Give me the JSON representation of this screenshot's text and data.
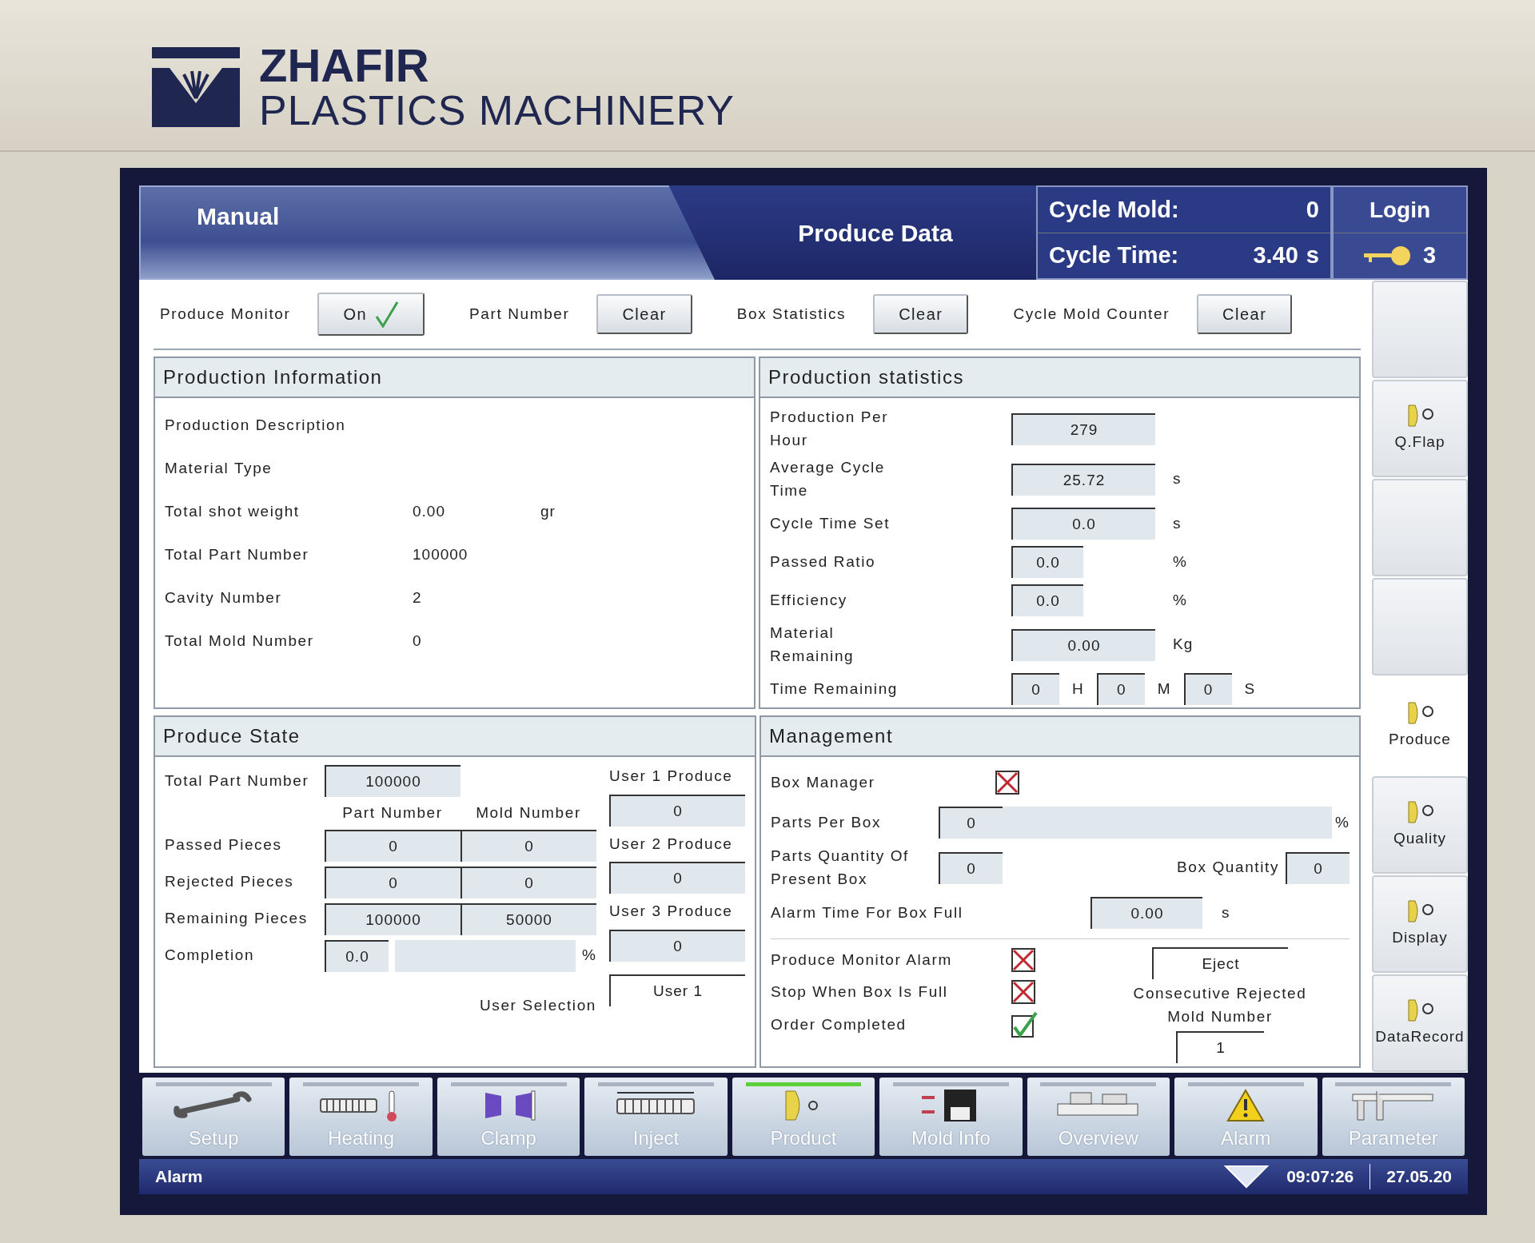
{
  "bezel": {
    "brand": "ZHAFIR",
    "subtitle": "PLASTICS MACHINERY"
  },
  "header": {
    "mode": "Manual",
    "title": "Produce Data",
    "cycle_mold_label": "Cycle Mold:",
    "cycle_mold": "0",
    "cycle_time_label": "Cycle Time:",
    "cycle_time": "3.40",
    "cycle_time_unit": "s",
    "login": "Login",
    "user_level": "3"
  },
  "toolbar": [
    {
      "kind": "toggle",
      "label": "Produce Monitor",
      "button": "On",
      "checked": true
    },
    {
      "kind": "clear",
      "label": "Part Number",
      "button": "Clear"
    },
    {
      "kind": "clear",
      "label": "Box Statistics",
      "button": "Clear"
    },
    {
      "kind": "clear",
      "label": "Cycle Mold Counter",
      "button": "Clear"
    }
  ],
  "production_information": {
    "title": "Production Information",
    "rows": [
      {
        "label": "Production Description"
      },
      {
        "label": "Material Type"
      },
      {
        "label": "Total shot weight",
        "value": "0.00",
        "unit": "gr"
      },
      {
        "label": "Total Part Number",
        "value": "100000"
      },
      {
        "label": "Cavity Number",
        "value": "2"
      },
      {
        "label": "Total Mold Number",
        "value": "0"
      }
    ]
  },
  "production_statistics": {
    "title": "Production statistics",
    "rows": [
      {
        "label": "Production Per Hour",
        "value": "279",
        "kind": "measure"
      },
      {
        "label": "Average Cycle Time",
        "value": "25.72",
        "unit": "s",
        "kind": "measure"
      },
      {
        "label": "Cycle Time Set",
        "value": "0.0",
        "unit": "s",
        "kind": "measure"
      },
      {
        "label": "Passed Ratio",
        "value": "0.0",
        "unit": "%",
        "kind": "ratio"
      },
      {
        "label": "Efficiency",
        "value": "0.0",
        "unit": "%",
        "kind": "ratio"
      },
      {
        "label": "Material Remaining",
        "value": "0.00",
        "unit": "Kg",
        "kind": "measure"
      }
    ],
    "time_remaining": {
      "label": "Time Remaining",
      "fields": [
        {
          "value": "0",
          "unit": "H"
        },
        {
          "value": "0",
          "unit": "M"
        },
        {
          "value": "0",
          "unit": "S"
        }
      ]
    }
  },
  "produce_state": {
    "title": "Produce State",
    "total_label": "Total Part Number",
    "total": "100000",
    "columns": [
      "Part Number",
      "Mold Number"
    ],
    "rows": [
      {
        "label": "Passed Pieces",
        "part": "0",
        "mold": "0"
      },
      {
        "label": "Rejected Pieces",
        "part": "0",
        "mold": "0"
      },
      {
        "label": "Remaining Pieces",
        "part": "100000",
        "mold": "50000"
      }
    ],
    "completion": {
      "label": "Completion",
      "value": "0.0",
      "unit": "%",
      "level": 0
    },
    "users": [
      {
        "label": "User 1 Produce",
        "value": "0"
      },
      {
        "label": "User 2 Produce",
        "value": "0"
      },
      {
        "label": "User 3 Produce",
        "value": "0"
      }
    ],
    "user_selection": {
      "label": "User Selection",
      "value": "User 1"
    }
  },
  "management": {
    "title": "Management",
    "box_manager": {
      "label": "Box Manager",
      "checked": false
    },
    "parts_per_box": {
      "label": "Parts Per Box",
      "value": "0",
      "unit": "%",
      "level": 0
    },
    "parts_present": {
      "label": "Parts Quantity Of Present Box",
      "value": "0"
    },
    "box_quantity": {
      "label": "Box Quantity",
      "value": "0"
    },
    "alarm_time": {
      "label": "Alarm Time For Box Full",
      "value": "0.00",
      "unit": "s"
    },
    "options": [
      {
        "label": "Produce Monitor Alarm",
        "checked": false
      },
      {
        "label": "Stop When Box Is Full",
        "checked": false
      },
      {
        "label": "Order Completed",
        "checked": true
      }
    ],
    "action": {
      "value": "Eject"
    },
    "consecutive": {
      "label": "Consecutive Rejected Mold Number",
      "value": "1"
    }
  },
  "side_tabs": [
    {
      "kind": "blank",
      "selected": false
    },
    {
      "kind": "page",
      "label": "Q.Flap",
      "selected": false
    },
    {
      "kind": "blank",
      "selected": false
    },
    {
      "kind": "blank",
      "selected": false
    },
    {
      "kind": "page",
      "label": "Produce",
      "selected": true
    },
    {
      "kind": "page",
      "label": "Quality",
      "selected": false
    },
    {
      "kind": "page",
      "label": "Display",
      "selected": false
    },
    {
      "kind": "page",
      "label": "DataRecord",
      "selected": false
    }
  ],
  "nav": [
    {
      "label": "Setup",
      "selected": false
    },
    {
      "label": "Heating",
      "selected": false
    },
    {
      "label": "Clamp",
      "selected": false
    },
    {
      "label": "Inject",
      "selected": false
    },
    {
      "label": "Product",
      "selected": true
    },
    {
      "label": "Mold Info",
      "selected": false
    },
    {
      "label": "Overview",
      "selected": false
    },
    {
      "label": "Alarm",
      "selected": false
    },
    {
      "label": "Parameter",
      "selected": false
    }
  ],
  "status_bar": {
    "alarm": "Alarm",
    "time": "09:07:26",
    "date": "27.05.20"
  }
}
